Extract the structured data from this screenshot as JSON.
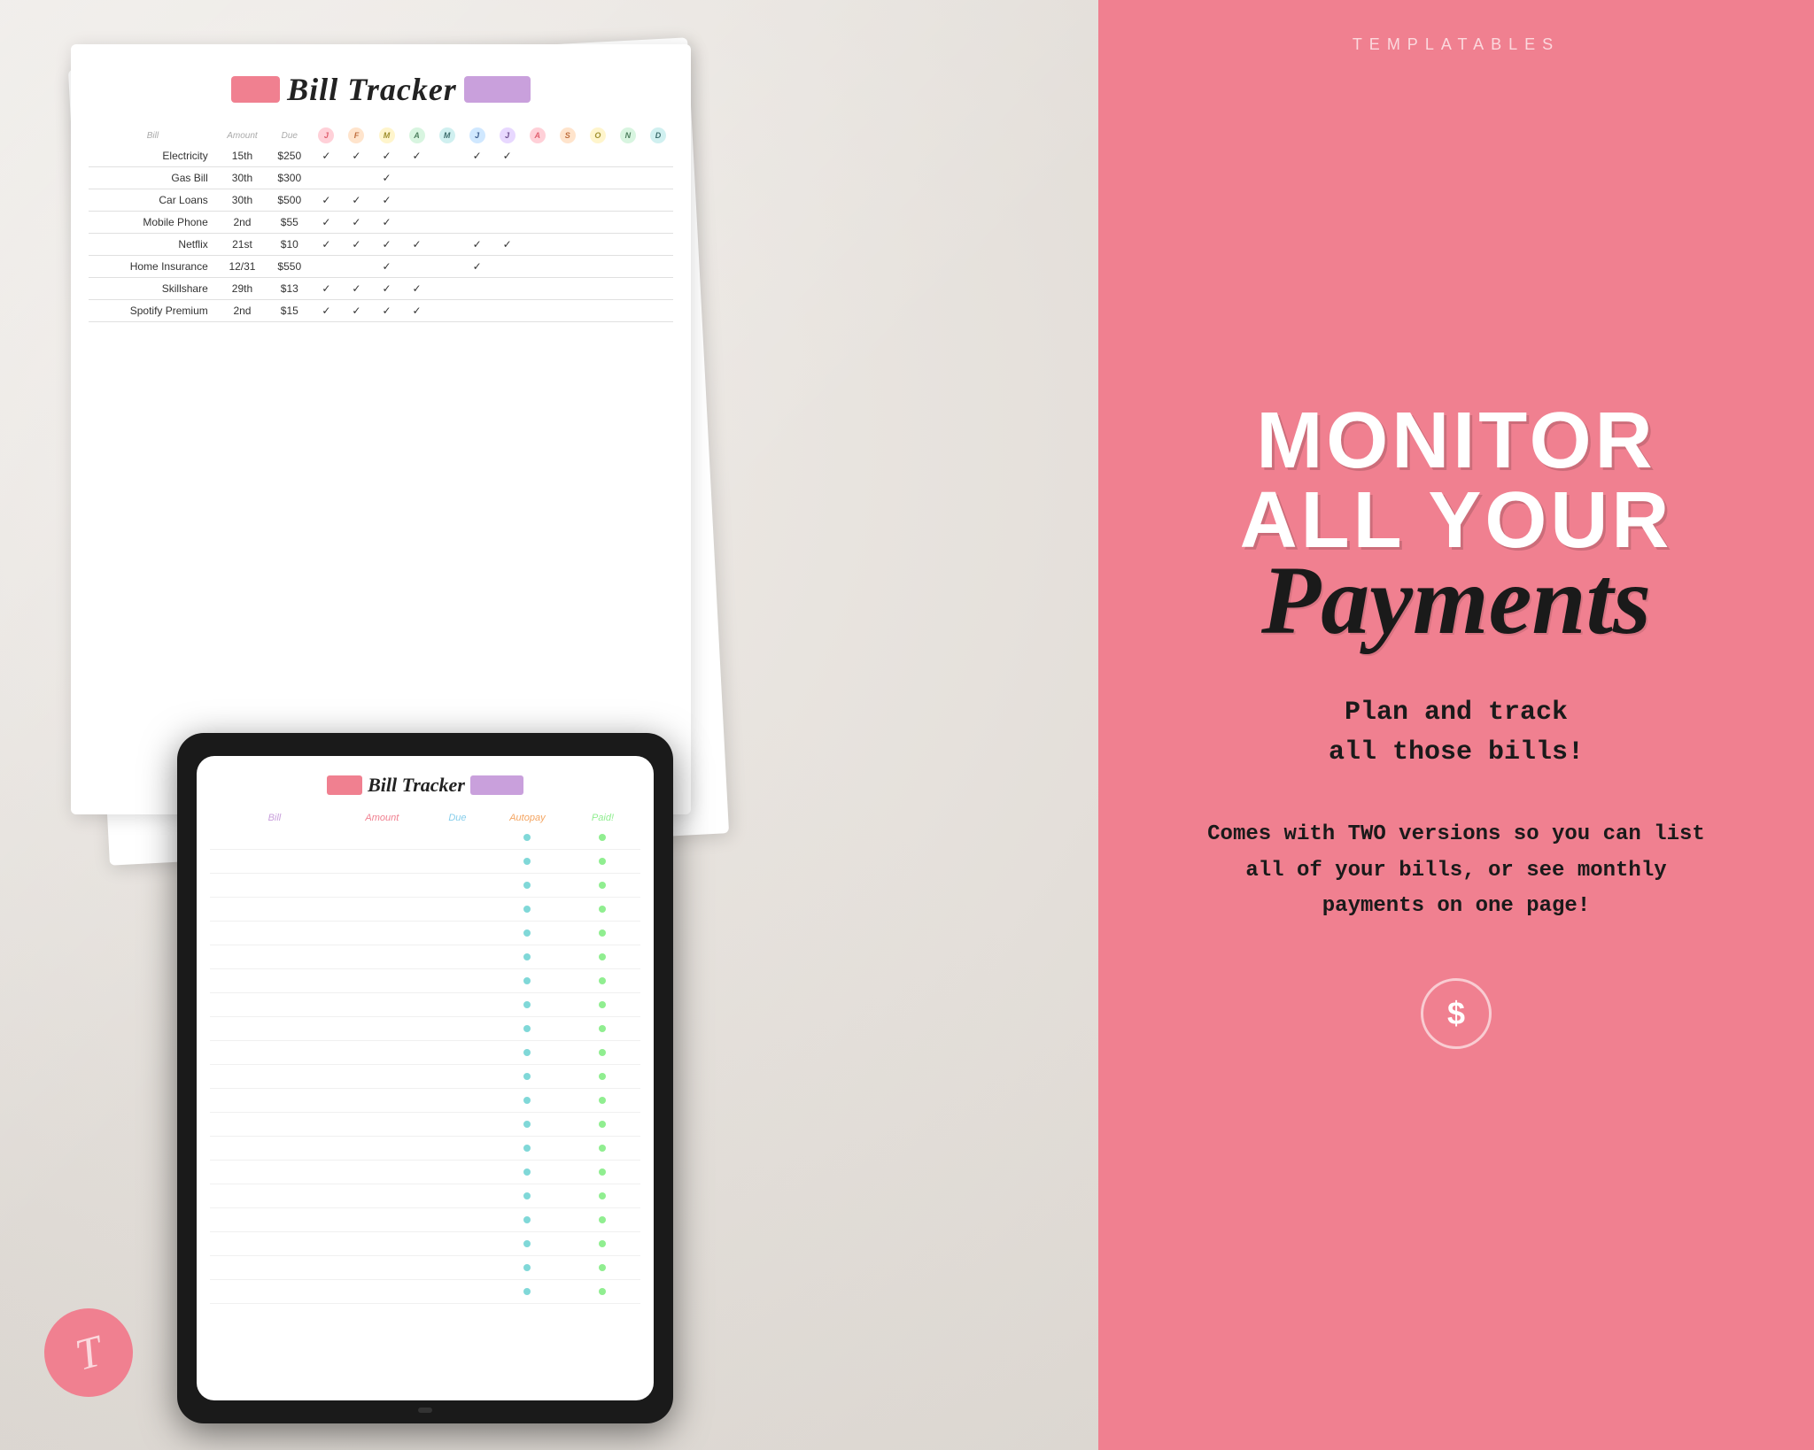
{
  "brand": "TEMPLATABLES",
  "left": {
    "paper_title": "Bill Tracker",
    "table_headers": {
      "bill": "Bill",
      "amount": "Amount",
      "due": "Due",
      "months": [
        "J",
        "F",
        "M",
        "A",
        "M",
        "J",
        "J",
        "A",
        "S",
        "O",
        "N",
        "D"
      ]
    },
    "rows": [
      {
        "bill": "Electricity",
        "due": "15th",
        "amount": "$250",
        "checks": "✓✓✓✓ ✓✓"
      },
      {
        "bill": "Gas Bill",
        "due": "30th",
        "amount": "$300",
        "checks": "  ✓"
      },
      {
        "bill": "Car Loans",
        "due": "30th",
        "amount": "$500",
        "checks": "✓✓✓"
      },
      {
        "bill": "Mobile Phone",
        "due": "2nd",
        "amount": "$55",
        "checks": "✓✓✓"
      },
      {
        "bill": "Netflix",
        "due": "21st",
        "amount": "$10",
        "checks": "✓✓✓✓ ✓✓"
      },
      {
        "bill": "Home Insurance",
        "due": "12/31",
        "amount": "$550",
        "checks": "  ✓  ✓"
      },
      {
        "bill": "Skillshare",
        "due": "29th",
        "amount": "$13",
        "checks": "✓✓✓✓"
      },
      {
        "bill": "Spotify Premium",
        "due": "2nd",
        "amount": "$15",
        "checks": "✓✓✓✓"
      }
    ]
  },
  "tablet": {
    "title": "Bill Tracker",
    "headers": {
      "bill": "Bill",
      "amount": "Amount",
      "due": "Due",
      "autopay": "Autopay",
      "paid": "Paid!"
    },
    "rows_count": 20
  },
  "right": {
    "headline_line1": "MONITOR",
    "headline_line2": "ALL YOUR",
    "headline_script": "Payments",
    "tagline1_line1": "Plan and track",
    "tagline1_line2": "all those bills!",
    "tagline2": "Comes with TWO versions so you can list all of your bills, or see monthly payments on one page!",
    "dollar_symbol": "$"
  }
}
